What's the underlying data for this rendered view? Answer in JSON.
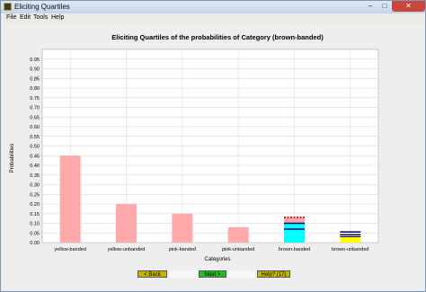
{
  "window": {
    "title": "Eliciting Quartiles",
    "close_glyph": "✕",
    "min_glyph": "–",
    "max_glyph": "□"
  },
  "menu": {
    "items": [
      "File",
      "Edit",
      "Tools",
      "Help"
    ]
  },
  "buttons": {
    "back": "< Back",
    "next": "Next >",
    "help": "Help? (17)"
  },
  "colors": {
    "bar": "#ffaaaa",
    "quartile_dark": "#000080",
    "quartile_red": "#dd2222",
    "median_cyan": "#00ffff",
    "low_yellow": "#ffff00"
  },
  "chart_data": {
    "type": "bar",
    "title": "Eliciting Quartiles of the probabilities of Category (brown-banded)",
    "xlabel": "Categories",
    "ylabel": "Probabilities",
    "ylim": [
      0,
      1.0
    ],
    "yticks": [
      0.0,
      0.05,
      0.1,
      0.15,
      0.2,
      0.25,
      0.3,
      0.35,
      0.4,
      0.45,
      0.5,
      0.55,
      0.6,
      0.65,
      0.7,
      0.75,
      0.8,
      0.85,
      0.9,
      0.95
    ],
    "ytick_labels": [
      "0.00",
      "0.05",
      "0.10",
      "0.15",
      "0.20",
      "0.25",
      "0.30",
      "0.35",
      "0.40",
      "0.45",
      "0.50",
      "0.55",
      "0.60",
      "0.65",
      "0.70",
      "0.75",
      "0.80",
      "0.85",
      "0.90",
      "0.95"
    ],
    "categories": [
      "yellow-banded",
      "yellow-unbanded",
      "pink-banded",
      "pink-unbanded",
      "brown-banded",
      "brown-unbanded"
    ],
    "values": [
      0.45,
      0.2,
      0.15,
      0.08,
      0.13,
      0.06
    ],
    "grid": true,
    "quartiles": [
      {
        "category": "brown-banded",
        "lower": 0.07,
        "median": 0.1,
        "upper": 0.13
      },
      {
        "category": "brown-unbanded",
        "lower": 0.03,
        "median": 0.04,
        "upper": 0.055
      }
    ]
  }
}
